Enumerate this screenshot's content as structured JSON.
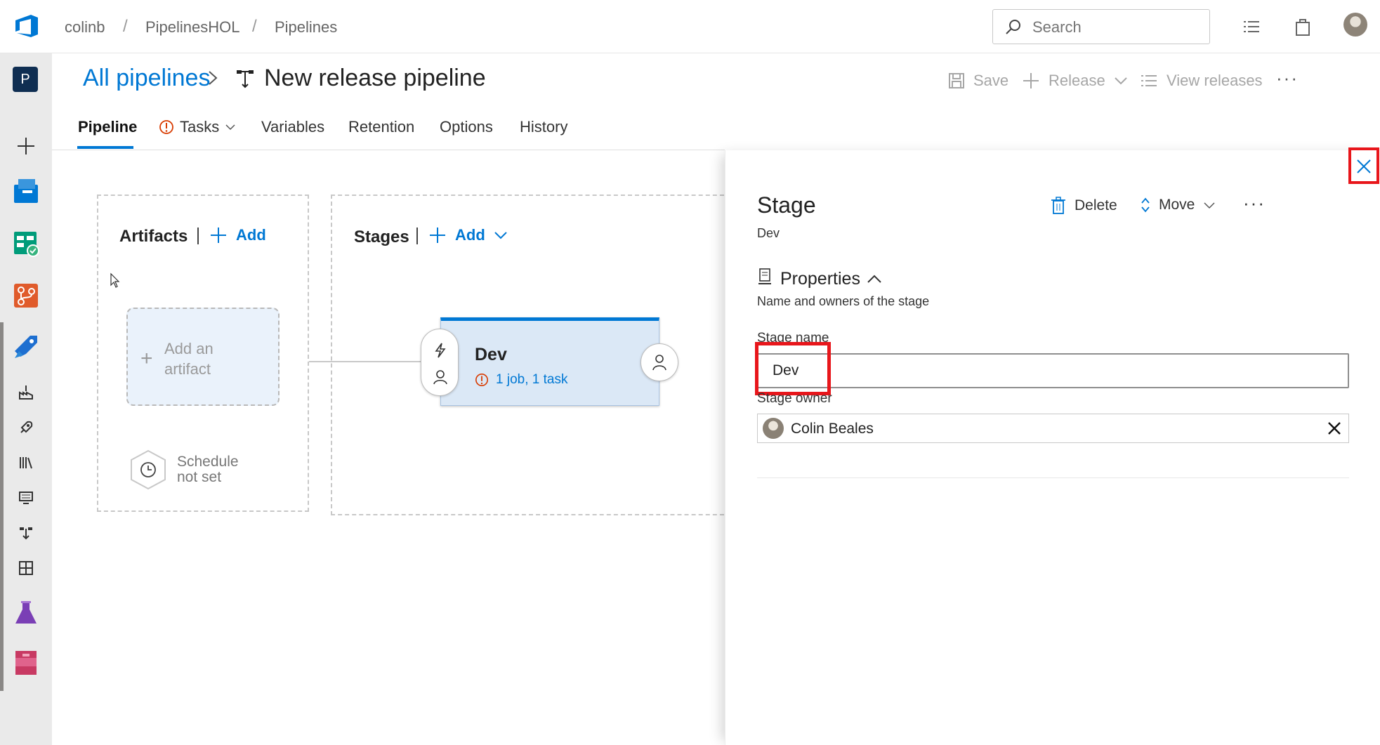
{
  "header": {
    "breadcrumbs": [
      "colinb",
      "PipelinesHOL",
      "Pipelines"
    ],
    "breadcrumb_separator": "/",
    "search_placeholder": "Search",
    "icons": [
      "azure-devops-logo",
      "work-items-list-icon",
      "marketplace-bag-icon",
      "user-avatar"
    ]
  },
  "leftnav": {
    "project_initial": "P",
    "items": [
      "new-item-plus",
      "overview",
      "boards",
      "repos",
      "pipelines",
      "builds",
      "releases",
      "library",
      "task-groups",
      "deployment-groups",
      "test-plans",
      "artifacts"
    ]
  },
  "page": {
    "parent_link": "All pipelines",
    "title": "New release pipeline",
    "commands": {
      "save": "Save",
      "release": "Release",
      "view_releases": "View releases",
      "more": "···"
    }
  },
  "tabs": [
    {
      "label": "Pipeline",
      "active": true
    },
    {
      "label": "Tasks",
      "has_warning": true,
      "has_dropdown": true
    },
    {
      "label": "Variables"
    },
    {
      "label": "Retention"
    },
    {
      "label": "Options"
    },
    {
      "label": "History"
    }
  ],
  "canvas": {
    "artifacts_title": "Artifacts",
    "artifacts_add": "Add",
    "add_artifact_label": "Add an artifact",
    "schedule_line1": "Schedule",
    "schedule_line2": "not set",
    "stages_title": "Stages",
    "stages_add": "Add",
    "stage": {
      "name": "Dev",
      "summary": "1 job, 1 task"
    }
  },
  "panel": {
    "title": "Stage",
    "subtitle": "Dev",
    "delete_label": "Delete",
    "move_label": "Move",
    "more": "···",
    "section_title": "Properties",
    "section_desc": "Name and owners of the stage",
    "stage_name_label": "Stage name",
    "stage_name_value": "Dev",
    "stage_owner_label": "Stage owner",
    "stage_owner_value": "Colin Beales"
  },
  "colors": {
    "accent": "#0078d4",
    "highlight": "#e8161b",
    "warning": "#d83b01"
  }
}
